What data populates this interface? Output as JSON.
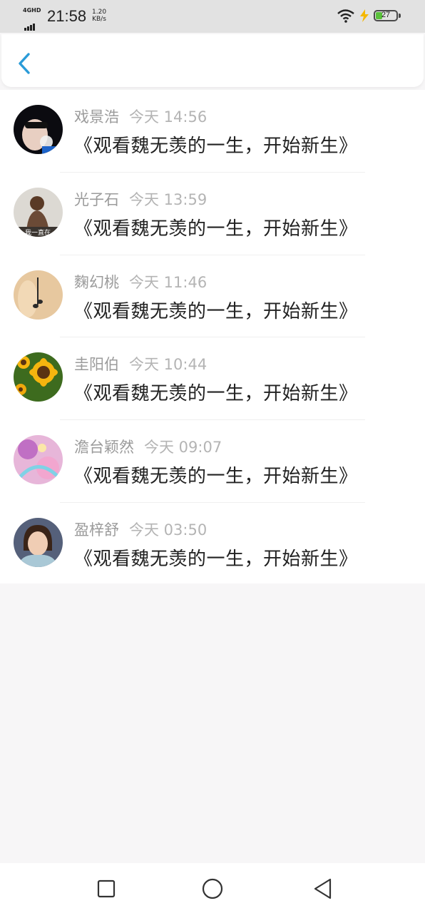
{
  "status_bar": {
    "network": "4GHD",
    "time": "21:58",
    "speed_value": "1.20",
    "speed_unit": "KB/s",
    "battery": "27",
    "icons": [
      "signal-icon",
      "wifi-icon",
      "charging-icon",
      "battery-icon"
    ]
  },
  "header": {
    "back_icon": "chevron-left-icon",
    "accent": "#2a9bd8"
  },
  "messages": [
    {
      "name": "戏景浩",
      "time": "今天 14:56",
      "title": "《观看魏无羡的一生，开始新生》",
      "avatar": "avatar-photo"
    },
    {
      "name": "光子石",
      "time": "今天 13:59",
      "title": "《观看魏无羡的一生，开始新生》",
      "avatar": "avatar-photo",
      "avatar_caption": "我一直在"
    },
    {
      "name": "麴幻桃",
      "time": "今天 11:46",
      "title": "《观看魏无羡的一生，开始新生》",
      "avatar": "avatar-photo"
    },
    {
      "name": "圭阳伯",
      "time": "今天 10:44",
      "title": "《观看魏无羡的一生，开始新生》",
      "avatar": "avatar-photo"
    },
    {
      "name": "澹台颖然",
      "time": "今天 09:07",
      "title": "《观看魏无羡的一生，开始新生》",
      "avatar": "avatar-photo"
    },
    {
      "name": "盈梓舒",
      "time": "今天 03:50",
      "title": "《观看魏无羡的一生，开始新生》",
      "avatar": "avatar-photo"
    }
  ],
  "bottom_nav": {
    "icons": [
      "recent-apps-icon",
      "home-icon",
      "back-triangle-icon"
    ]
  }
}
